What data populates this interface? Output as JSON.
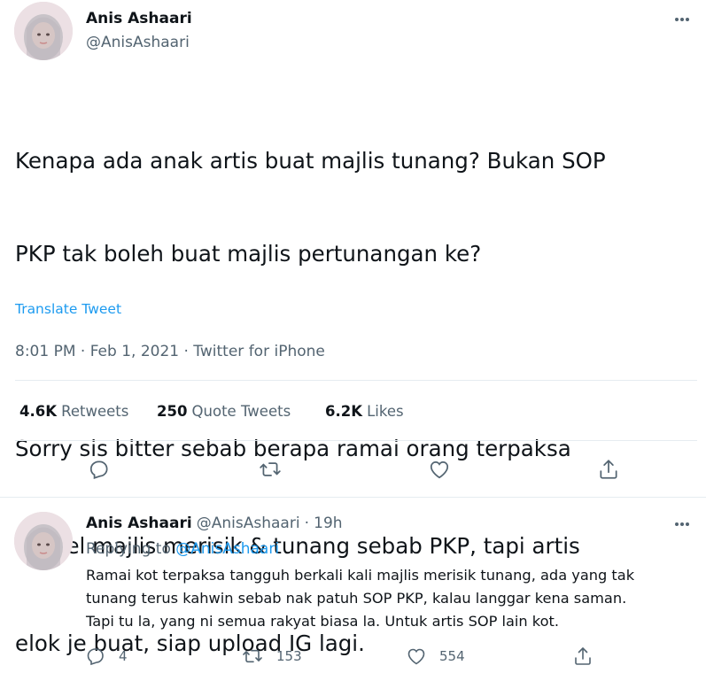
{
  "main_tweet": {
    "author_name": "Anis Ashaari",
    "author_handle": "@AnisAshaari",
    "text_lines": [
      "Kenapa ada anak artis buat majlis tunang? Bukan SOP",
      "PKP tak boleh buat majlis pertunangan ke?",
      "",
      "Sorry sis bitter sebab berapa ramai orang terpaksa",
      "cancel majlis merisik & tunang sebab PKP, tapi artis",
      "elok je buat, siap upload IG lagi."
    ],
    "translate_label": "Translate Tweet",
    "timestamp": "8:01 PM · Feb 1, 2021 · Twitter for iPhone",
    "stats": {
      "retweets_count": "4.6K",
      "retweets_label": "Retweets",
      "quotes_count": "250",
      "quotes_label": "Quote Tweets",
      "likes_count": "6.2K",
      "likes_label": "Likes"
    },
    "actions": [
      "reply-icon",
      "retweet-icon",
      "like-icon",
      "share-icon"
    ]
  },
  "reply_tweet": {
    "author_name": "Anis Ashaari",
    "author_handle": "@AnisAshaari",
    "separator": "·",
    "time": "19h",
    "replying_prefix": "Replying to",
    "replying_handle": "@AnisAshaari",
    "text_lines": [
      "Ramai kot terpaksa tangguh berkali kali majlis merisik tunang, ada yang tak",
      "tunang terus kahwin sebab nak patuh SOP PKP, kalau langgar kena saman.",
      "Tapi tu la, yang ni semua rakyat biasa la. Untuk artis SOP lain kot."
    ],
    "reply_count": "4",
    "retweet_count": "153",
    "like_count": "554"
  },
  "colors": {
    "accent": "#1d9bf0",
    "text_primary": "#0f1419",
    "text_secondary": "#536471",
    "divider": "#e6ecf0"
  }
}
